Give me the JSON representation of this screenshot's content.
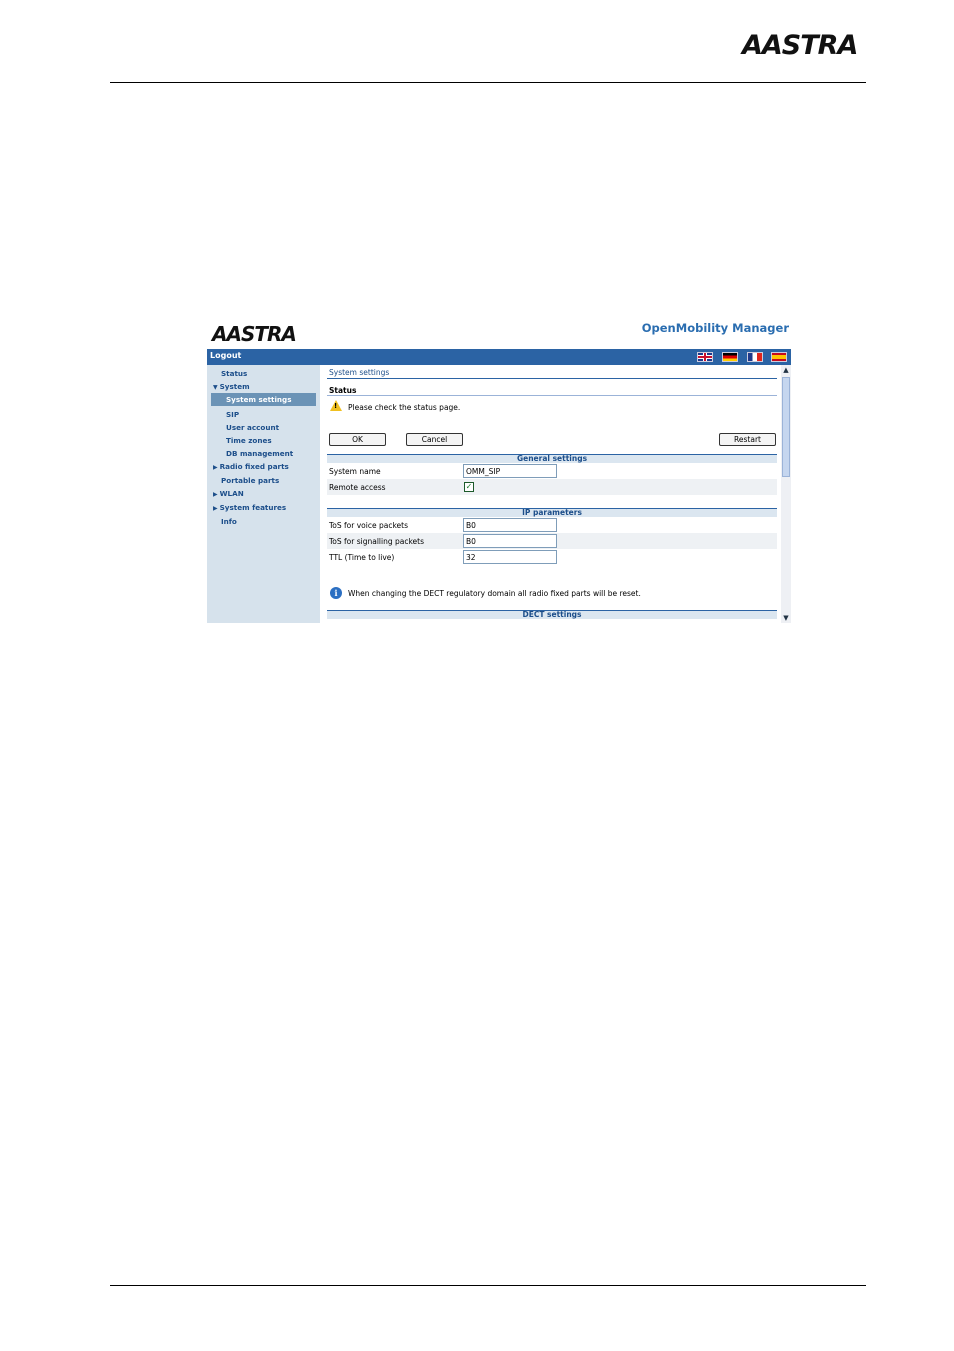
{
  "page": {
    "logo": "AASTRA"
  },
  "app": {
    "logo": "AASTRA",
    "title": "OpenMobility Manager",
    "logout": "Logout",
    "languages": [
      "English",
      "Deutsch",
      "Français",
      "Español"
    ]
  },
  "sidebar": {
    "items": [
      {
        "label": "Status"
      },
      {
        "label": "System",
        "expanded": true
      },
      {
        "label": "System settings",
        "active": true
      },
      {
        "label": "SIP"
      },
      {
        "label": "User account"
      },
      {
        "label": "Time zones"
      },
      {
        "label": "DB management"
      },
      {
        "label": "Radio fixed parts"
      },
      {
        "label": "Portable parts"
      },
      {
        "label": "WLAN"
      },
      {
        "label": "System features"
      },
      {
        "label": "Info"
      }
    ]
  },
  "content": {
    "title": "System settings",
    "status_label": "Status",
    "status_message": "Please check the status page.",
    "buttons": {
      "ok": "OK",
      "cancel": "Cancel",
      "restart": "Restart"
    },
    "general": {
      "heading": "General settings",
      "system_name_label": "System name",
      "system_name_value": "OMM_SIP",
      "remote_access_label": "Remote access",
      "remote_access_checked": true
    },
    "ip": {
      "heading": "IP parameters",
      "tos_voice_label": "ToS for voice packets",
      "tos_voice_value": "B0",
      "tos_signalling_label": "ToS for signalling packets",
      "tos_signalling_value": "B0",
      "ttl_label": "TTL (Time to live)",
      "ttl_value": "32"
    },
    "info_message": "When changing the DECT regulatory domain all radio fixed parts will be reset.",
    "dect_heading": "DECT settings"
  },
  "colors": {
    "topbar": "#2b63a4",
    "sidebar_bg": "#d6e2ec",
    "nav_text": "#1c4e8a",
    "active_nav": "#6b93b6",
    "title_blue": "#2a6db0"
  }
}
